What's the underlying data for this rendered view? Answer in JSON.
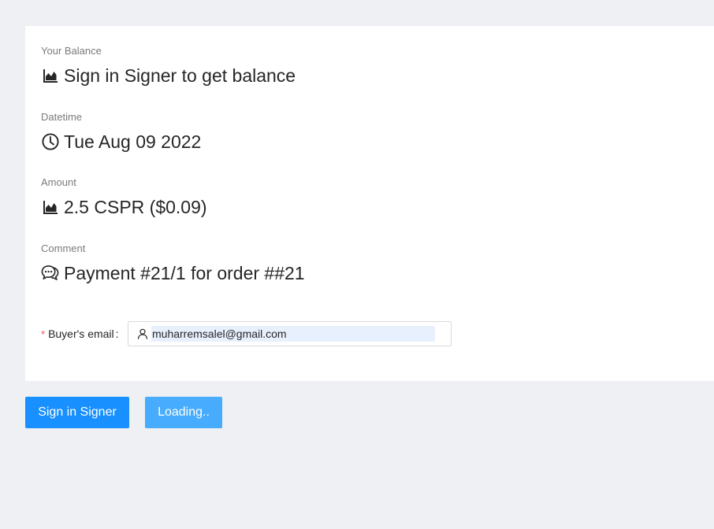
{
  "balance": {
    "label": "Your Balance",
    "value": "Sign in Signer to get balance",
    "icon": "area-chart-icon"
  },
  "datetime": {
    "label": "Datetime",
    "value": "Tue Aug 09 2022",
    "icon": "clock-icon"
  },
  "amount": {
    "label": "Amount",
    "value": "2.5 CSPR ($0.09)",
    "icon": "area-chart-icon"
  },
  "comment": {
    "label": "Comment",
    "value": "Payment #21/1 for order ##21",
    "icon": "comments-icon"
  },
  "form": {
    "email_label": "Buyer's email",
    "email_label_suffix": ":",
    "required_mark": "*",
    "email_value": "muharremsalel@gmail.com",
    "email_icon": "user-icon"
  },
  "buttons": {
    "sign_in_label": "Sign in Signer",
    "loading_label": "Loading.."
  },
  "colors": {
    "primary": "#1890ff",
    "primary_light": "#40a9ff",
    "required": "#ff4d4f",
    "autofill_bg": "#e8f0fe",
    "page_bg": "#eef0f3"
  }
}
